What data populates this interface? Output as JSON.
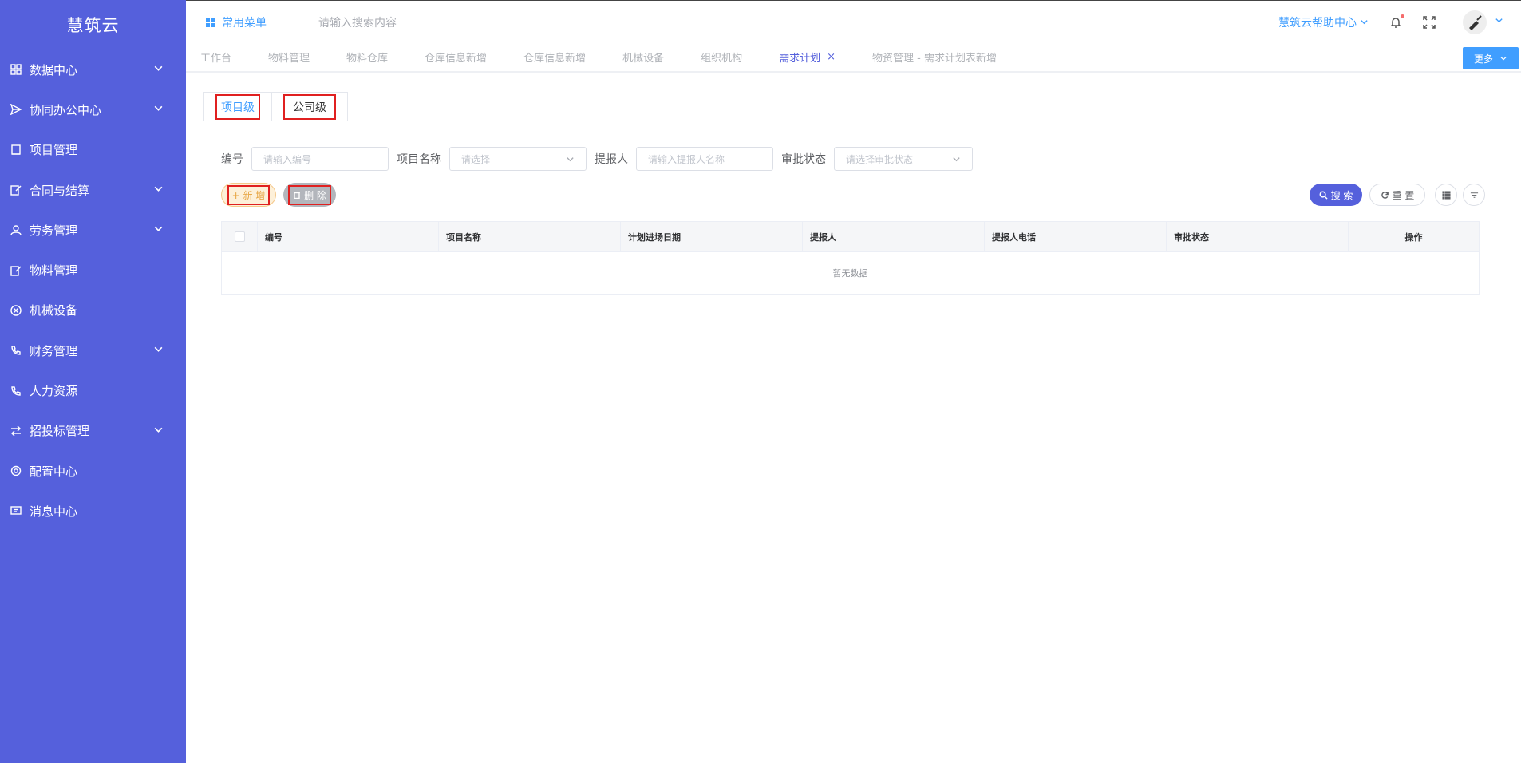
{
  "brand": "慧筑云",
  "sidebar": {
    "items": [
      {
        "label": "数据中心",
        "icon": "grid-icon",
        "expandable": true
      },
      {
        "label": "协同办公中心",
        "icon": "send-icon",
        "expandable": true
      },
      {
        "label": "项目管理",
        "icon": "book-icon",
        "expandable": false
      },
      {
        "label": "合同与结算",
        "icon": "edit-icon",
        "expandable": true
      },
      {
        "label": "劳务管理",
        "icon": "user-icon",
        "expandable": true
      },
      {
        "label": "物料管理",
        "icon": "edit-icon",
        "expandable": false
      },
      {
        "label": "机械设备",
        "icon": "circle-x-icon",
        "expandable": false
      },
      {
        "label": "财务管理",
        "icon": "phone-icon",
        "expandable": true
      },
      {
        "label": "人力资源",
        "icon": "phone-icon",
        "expandable": false
      },
      {
        "label": "招投标管理",
        "icon": "transfer-icon",
        "expandable": true
      },
      {
        "label": "配置中心",
        "icon": "gear-icon",
        "expandable": false
      },
      {
        "label": "消息中心",
        "icon": "message-icon",
        "expandable": false
      }
    ]
  },
  "header": {
    "common_menu": "常用菜单",
    "search_placeholder": "请输入搜索内容",
    "help_center": "慧筑云帮助中心"
  },
  "tags": {
    "items": [
      {
        "label": "工作台",
        "active": false
      },
      {
        "label": "物料管理",
        "active": false
      },
      {
        "label": "物料仓库",
        "active": false
      },
      {
        "label": "仓库信息新增",
        "active": false
      },
      {
        "label": "仓库信息新增",
        "active": false
      },
      {
        "label": "机械设备",
        "active": false
      },
      {
        "label": "组织机构",
        "active": false
      },
      {
        "label": "需求计划",
        "active": true
      },
      {
        "label": "物资管理 - 需求计划表新增",
        "active": false
      }
    ],
    "close_glyph": "×",
    "more_label": "更多"
  },
  "level_tabs": {
    "project": "项目级",
    "company": "公司级"
  },
  "filters": {
    "code_label": "编号",
    "code_placeholder": "请输入编号",
    "project_label": "项目名称",
    "project_placeholder": "请选择",
    "reporter_label": "提报人",
    "reporter_placeholder": "请输入提报人名称",
    "status_label": "审批状态",
    "status_placeholder": "请选择审批状态"
  },
  "actions": {
    "add_label": "+ 新 增",
    "delete_label": "删 除",
    "search_label": "搜 索",
    "reset_label": "重 置"
  },
  "table": {
    "columns": [
      "编号",
      "项目名称",
      "计划进场日期",
      "提报人",
      "提报人电话",
      "审批状态",
      "操作"
    ],
    "empty_text": "暂无数据"
  },
  "colors": {
    "sidebar_bg": "#5560dc",
    "primary": "#409eff",
    "accent": "#5560dc",
    "highlight_box": "#e02020"
  }
}
